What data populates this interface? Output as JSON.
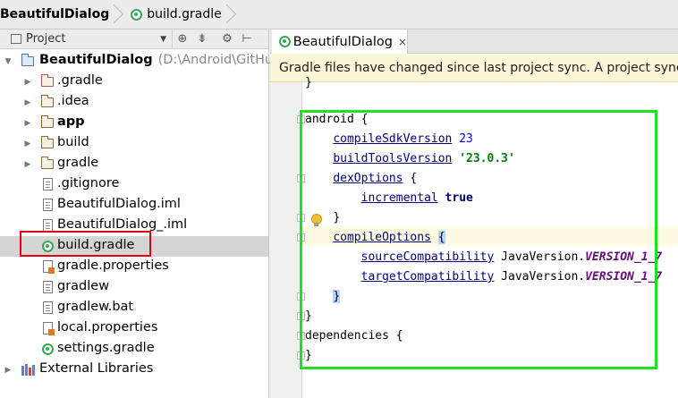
{
  "breadcrumbs": [
    "BeautifulDialog",
    "build.gradle"
  ],
  "project_panel": {
    "view_label": "Project",
    "root": {
      "name": "BeautifulDialog",
      "path": "(D:\\Android\\GitHub\\v"
    },
    "items": [
      {
        "label": ".gradle",
        "kind": "folder-red",
        "bold": false
      },
      {
        "label": ".idea",
        "kind": "folder",
        "bold": false
      },
      {
        "label": "app",
        "kind": "folder",
        "bold": true
      },
      {
        "label": "build",
        "kind": "folder",
        "bold": false
      },
      {
        "label": "gradle",
        "kind": "folder",
        "bold": false
      },
      {
        "label": ".gitignore",
        "kind": "file",
        "bold": false
      },
      {
        "label": "BeautifulDialog.iml",
        "kind": "file",
        "bold": false
      },
      {
        "label": "BeautifulDialog_.iml",
        "kind": "file",
        "bold": false
      },
      {
        "label": "build.gradle",
        "kind": "gradle",
        "bold": false,
        "selected": true
      },
      {
        "label": "gradle.properties",
        "kind": "properties",
        "bold": false
      },
      {
        "label": "gradlew",
        "kind": "file",
        "bold": false
      },
      {
        "label": "gradlew.bat",
        "kind": "file",
        "bold": false
      },
      {
        "label": "local.properties",
        "kind": "properties",
        "bold": false
      },
      {
        "label": "settings.gradle",
        "kind": "gradle",
        "bold": false
      }
    ],
    "external_libraries": "External Libraries"
  },
  "editor_tab": {
    "label": "BeautifulDialog",
    "close": "×"
  },
  "notification": "Gradle files have changed since last project sync. A project sync ma",
  "code": {
    "l_android": "android {",
    "l_compileSdk_key": "compileSdkVersion",
    "l_compileSdk_val": "23",
    "l_buildTools_key": "buildToolsVersion",
    "l_buildTools_val": "'23.0.3'",
    "l_dex_key": "dexOptions",
    "l_dex_open": " {",
    "l_incr_key": "incremental",
    "l_incr_val": "true",
    "l_close1": "}",
    "l_compileOpt_key": "compileOptions",
    "l_compileOpt_open": "{",
    "l_source_key": "sourceCompatibility",
    "l_target_key": "targetCompatibility",
    "l_javaversion": "JavaVersion.",
    "l_version_const": "VERSION_1_7",
    "l_close2": "}",
    "l_close3": "}",
    "l_deps": "dependencies {",
    "l_close4": "}",
    "l_top_brace": "}"
  },
  "colors": {
    "highlight_green": "#20e020",
    "highlight_red": "#e3000f",
    "gradle_green": "#3aa757"
  }
}
